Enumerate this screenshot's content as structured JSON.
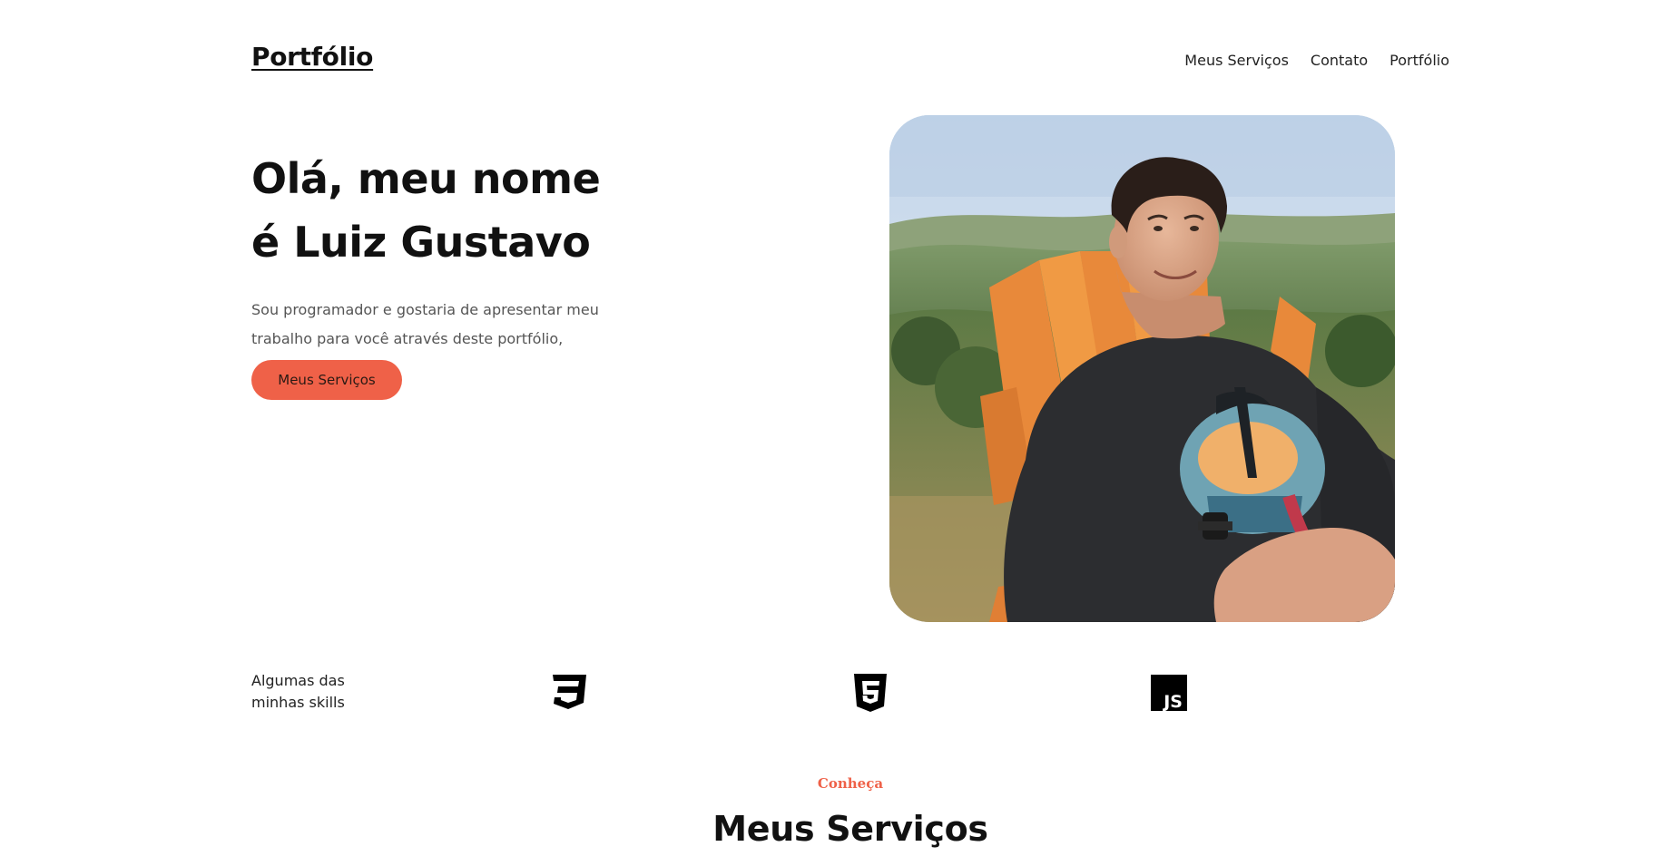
{
  "header": {
    "logo": "Portfólio",
    "nav": [
      {
        "label": "Meus Serviços"
      },
      {
        "label": "Contato"
      },
      {
        "label": "Portfólio"
      }
    ]
  },
  "hero": {
    "title_line1": "Olá, meu nome",
    "title_line2": "é Luiz Gustavo",
    "description": "Sou programador e gostaria de apresentar meu trabalho para você através deste portfólio,",
    "cta_label": "Meus Serviços",
    "accent_color": "#ef6148"
  },
  "skills": {
    "label": "Algumas das minhas skills",
    "icons": [
      "css3-icon",
      "html5-icon",
      "javascript-icon"
    ]
  },
  "services": {
    "kicker": "Conheça",
    "title": "Meus Serviços"
  }
}
